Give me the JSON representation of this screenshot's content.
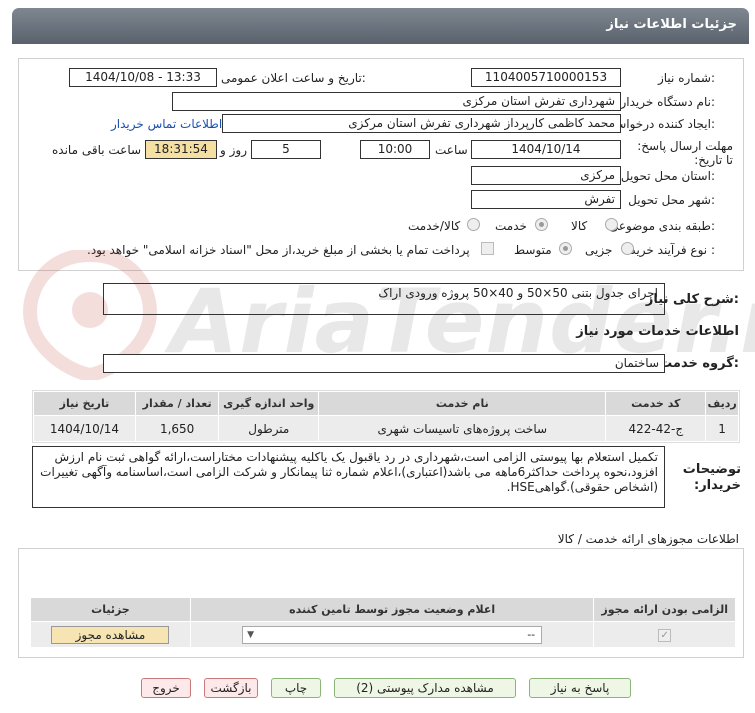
{
  "header": {
    "title": "جزئیات اطلاعات نیاز"
  },
  "form": {
    "need_number_label": "شماره نیاز:",
    "need_number": "1104005710000153",
    "announce_label": "تاریخ و ساعت اعلان عمومی:",
    "announce_value": "1404/10/08 - 13:33",
    "buyer_org_label": "نام دستگاه خریدار:",
    "buyer_org": "شهرداری تفرش استان مرکزی",
    "creator_label": "ایجاد کننده درخواست:",
    "creator": "محمد کاظمی کارپرداز شهرداری تفرش استان مرکزی",
    "contact_link": "اطلاعات تماس خریدار",
    "deadline_label": "مهلت ارسال پاسخ: تا تاریخ:",
    "deadline_date": "1404/10/14",
    "time_label": "ساعت",
    "deadline_time": "10:00",
    "days_value": "5",
    "days_label": "روز و",
    "remaining_time": "18:31:54",
    "remaining_label": "ساعت باقی مانده",
    "province_label": "استان محل تحویل:",
    "province": "مرکزی",
    "city_label": "شهر محل تحویل:",
    "city": "تفرش",
    "category_label": "طبقه بندی موضوعی:",
    "category_options": [
      "کالا",
      "خدمت",
      "کالا/خدمت"
    ],
    "category_selected": "خدمت",
    "process_label": "نوع فرآیند خرید :",
    "process_options": [
      "جزیی",
      "متوسط"
    ],
    "process_selected": "متوسط",
    "payment_note": "پرداخت تمام یا بخشی از مبلغ خرید،از محل \"اسناد خزانه اسلامی\" خواهد بود."
  },
  "need": {
    "summary_label": "شرح کلی نیاز:",
    "summary": "اجرای جدول بتنی 50×50 و 40×50 پروژه ورودی اراک",
    "services_title": "اطلاعات خدمات مورد نیاز",
    "service_group_label": "گروه خدمت:",
    "service_group": "ساختمان"
  },
  "services_table": {
    "headers": [
      "ردیف",
      "کد خدمت",
      "نام خدمت",
      "واحد اندازه گیری",
      "تعداد / مقدار",
      "تاریخ نیاز"
    ],
    "rows": [
      [
        "1",
        "ج-42-422",
        "ساخت پروژه‌های تاسیسات شهری",
        "مترطول",
        "1,650",
        "1404/10/14"
      ]
    ]
  },
  "buyer_notes": {
    "label": "توضیحات خریدار:",
    "text": "تکمیل استعلام بها پیوستی الزامی است،شهرداری در رد یاقبول یک یاکلیه پیشنهادات مختاراست،ارائه گواهی ثبت نام ارزش افزود،نحوه پرداخت حداکثر6ماهه می باشد(اعتباری)،اعلام شماره ثنا پیمانکار و شرکت الزامی است،اساسنامه وآگهی تغییرات (اشخاص حقوقی).گواهیHSE."
  },
  "permits": {
    "title": "اطلاعات مجوزهای ارائه خدمت / کالا",
    "headers": [
      "الزامی بودن ارائه مجوز",
      "اعلام وضعیت مجوز توسط تامین کننده",
      "جزئیات"
    ],
    "select_value": "--",
    "view_button": "مشاهده مجوز"
  },
  "actions": {
    "reply": "پاسخ به نیاز",
    "attachments": "مشاهده مدارک پیوستی (2)",
    "print": "چاپ",
    "back": "بازگشت",
    "exit": "خروج"
  },
  "watermark": {
    "text": "AriaTender.neT"
  }
}
